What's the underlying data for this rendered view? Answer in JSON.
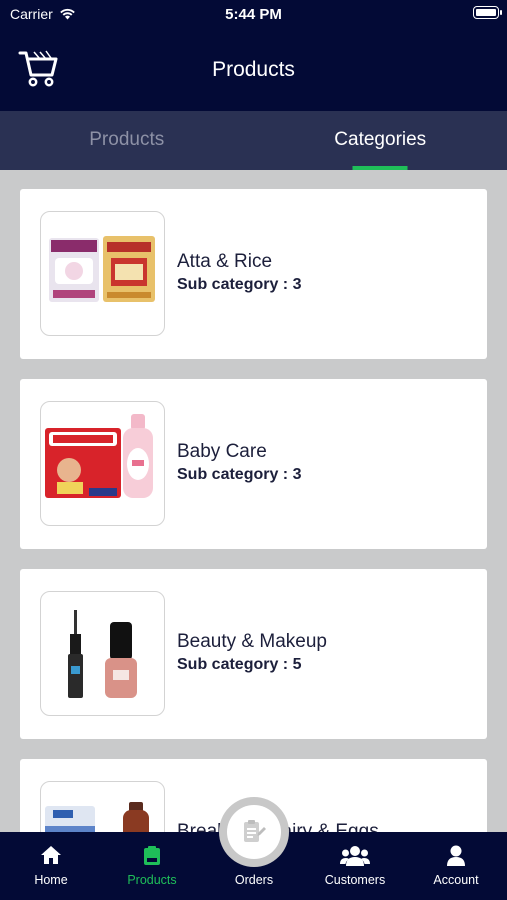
{
  "status_bar": {
    "carrier": "Carrier",
    "time": "5:44 PM"
  },
  "header": {
    "title": "Products",
    "cart_icon": "cart-icon"
  },
  "tabs": [
    {
      "label": "Products",
      "active": false
    },
    {
      "label": "Categories",
      "active": true
    }
  ],
  "categories": [
    {
      "name": "Atta & Rice",
      "sub": "Sub category : 3"
    },
    {
      "name": "Baby Care",
      "sub": "Sub category : 3"
    },
    {
      "name": "Beauty & Makeup",
      "sub": "Sub category : 5"
    },
    {
      "name": "Breakfast, Dairy & Eggs",
      "sub": ""
    }
  ],
  "tab_bar": [
    {
      "label": "Home",
      "icon": "home-icon"
    },
    {
      "label": "Products",
      "icon": "products-icon",
      "selected": true
    },
    {
      "label": "Orders",
      "icon": "orders-icon"
    },
    {
      "label": "Customers",
      "icon": "customers-icon"
    },
    {
      "label": "Account",
      "icon": "account-icon"
    }
  ],
  "colors": {
    "header_bg": "#030a36",
    "tabs_bg": "#2a3153",
    "accent": "#1fbf59",
    "list_bg": "#c9cacb"
  }
}
